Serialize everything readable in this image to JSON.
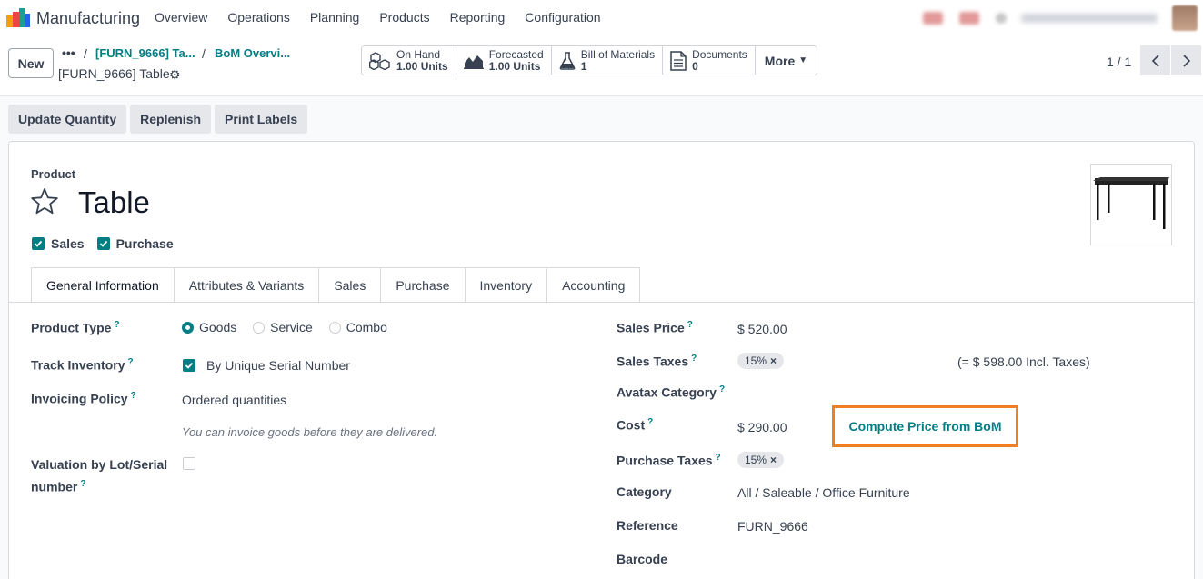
{
  "navbar": {
    "app_name": "Manufacturing",
    "menu": [
      "Overview",
      "Operations",
      "Planning",
      "Products",
      "Reporting",
      "Configuration"
    ]
  },
  "control": {
    "new_label": "New",
    "breadcrumb_dots": "•••",
    "breadcrumb_1": "[FURN_9666] Ta...",
    "breadcrumb_2": "BoM Overvi...",
    "current_record": "[FURN_9666] Table",
    "smart_buttons": [
      {
        "label": "On Hand",
        "value": "1.00 Units",
        "icon": "cubes-icon"
      },
      {
        "label": "Forecasted",
        "value": "1.00 Units",
        "icon": "area-chart-icon"
      },
      {
        "label": "Bill of Materials",
        "value": "1",
        "icon": "flask-icon"
      },
      {
        "label": "Documents",
        "value": "0",
        "icon": "document-icon"
      }
    ],
    "more_label": "More",
    "pager": "1 / 1"
  },
  "actions": [
    "Update Quantity",
    "Replenish",
    "Print Labels"
  ],
  "form": {
    "product_label": "Product",
    "title": "Table",
    "sales_label": "Sales",
    "purchase_label": "Purchase",
    "tabs": [
      "General Information",
      "Attributes & Variants",
      "Sales",
      "Purchase",
      "Inventory",
      "Accounting"
    ],
    "left": {
      "product_type_label": "Product Type",
      "product_type_options": [
        "Goods",
        "Service",
        "Combo"
      ],
      "product_type_selected": "Goods",
      "track_inventory_label": "Track Inventory",
      "track_inventory_value": "By Unique Serial Number",
      "invoicing_policy_label": "Invoicing Policy",
      "invoicing_policy_value": "Ordered quantities",
      "invoicing_hint": "You can invoice goods before they are delivered.",
      "valuation_label_1": "Valuation by Lot/Serial",
      "valuation_label_2": "number"
    },
    "right": {
      "sales_price_label": "Sales Price",
      "sales_price_value": "$ 520.00",
      "sales_taxes_label": "Sales Taxes",
      "sales_taxes_badge": "15%",
      "incl_taxes": "(= $ 598.00 Incl. Taxes)",
      "avatax_label": "Avatax Category",
      "cost_label": "Cost",
      "cost_value": "$ 290.00",
      "compute_price": "Compute Price from BoM",
      "purchase_taxes_label": "Purchase Taxes",
      "purchase_taxes_badge": "15%",
      "category_label": "Category",
      "category_value": "All / Saleable / Office Furniture",
      "reference_label": "Reference",
      "reference_value": "FURN_9666",
      "barcode_label": "Barcode"
    },
    "help_mark": "?",
    "remove_mark": "×"
  },
  "colors": {
    "accent": "#017e84",
    "highlight": "#f07f24"
  }
}
